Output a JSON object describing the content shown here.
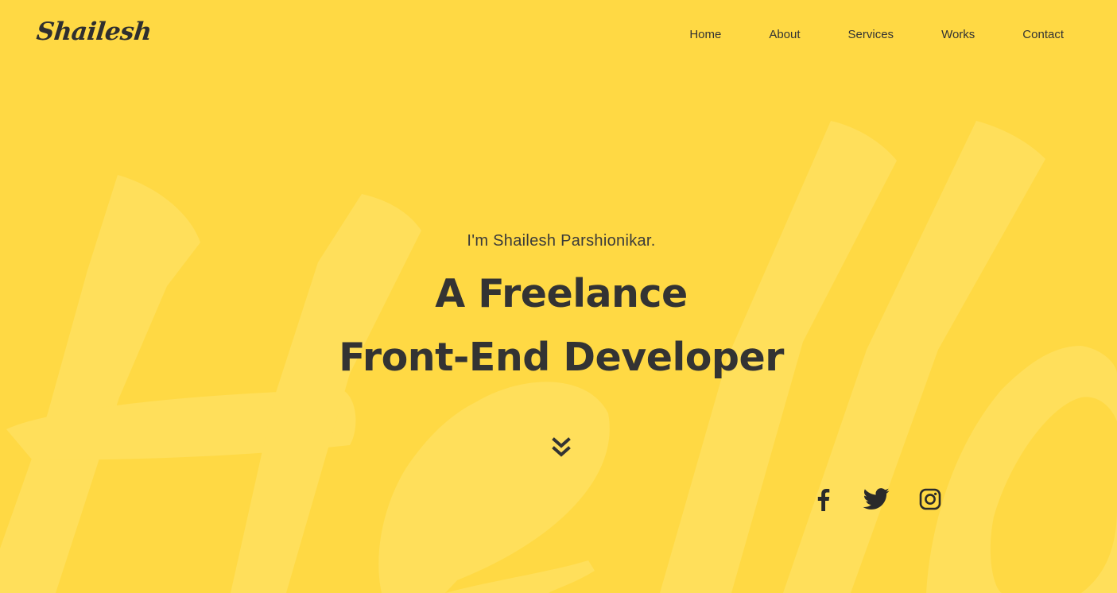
{
  "colors": {
    "background": "#FFD944",
    "watermark": "#FFDF5B",
    "text": "#333333"
  },
  "header": {
    "logo": "Shailesh",
    "nav": [
      {
        "label": "Home"
      },
      {
        "label": "About"
      },
      {
        "label": "Services"
      },
      {
        "label": "Works"
      },
      {
        "label": "Contact"
      }
    ]
  },
  "hero": {
    "intro": "I'm Shailesh Parshionikar.",
    "headline_line1": "A Freelance",
    "headline_line2": "Front-End Developer",
    "scroll_icon": "double-chevron-down-icon"
  },
  "social": [
    {
      "icon": "facebook-icon"
    },
    {
      "icon": "twitter-icon"
    },
    {
      "icon": "instagram-icon"
    }
  ]
}
